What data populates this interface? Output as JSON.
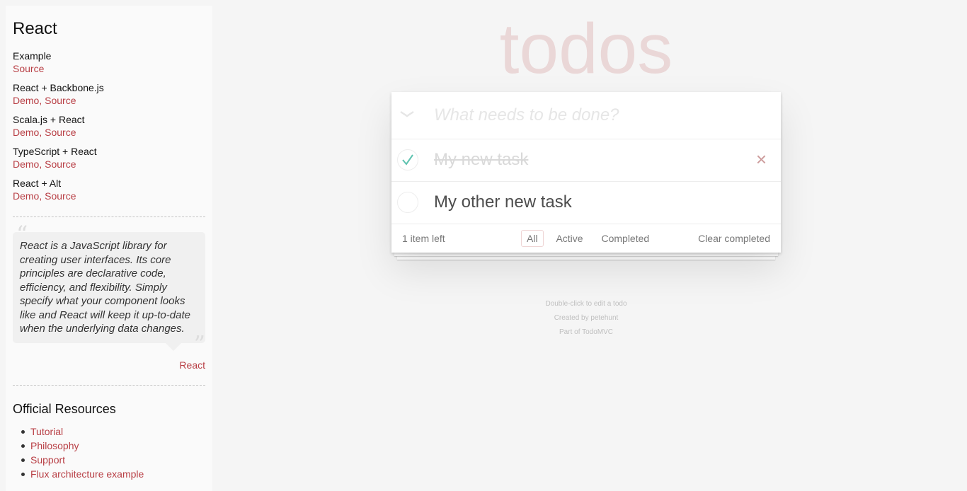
{
  "sidebar": {
    "title": "React",
    "examples": [
      {
        "name": "Example",
        "links": [
          "Source"
        ]
      },
      {
        "name": "React + Backbone.js",
        "links": [
          "Demo",
          "Source"
        ]
      },
      {
        "name": "Scala.js + React",
        "links": [
          "Demo",
          "Source"
        ]
      },
      {
        "name": "TypeScript + React",
        "links": [
          "Demo",
          "Source"
        ]
      },
      {
        "name": "React + Alt",
        "links": [
          "Demo",
          "Source"
        ]
      }
    ],
    "link_separator": ", ",
    "quote": {
      "text": "React is a JavaScript library for creating user interfaces. Its core principles are declarative code, efficiency, and flexibility. Simply specify what your component looks like and React will keep it up-to-date when the underlying data changes.",
      "source": "React",
      "open_mark": "“",
      "close_mark": "”"
    },
    "resources_title": "Official Resources",
    "resources": [
      "Tutorial",
      "Philosophy",
      "Support",
      "Flux architecture example"
    ]
  },
  "app": {
    "title": "todos",
    "new_todo_placeholder": "What needs to be done?",
    "new_todo_value": "",
    "toggle_all_glyph": "❯",
    "destroy_glyph": "×",
    "todos": [
      {
        "title": "My new task",
        "completed": true
      },
      {
        "title": "My other new task",
        "completed": false
      }
    ],
    "footer": {
      "count": "1 item left",
      "filters": [
        "All",
        "Active",
        "Completed"
      ],
      "selected_filter": "All",
      "clear": "Clear completed"
    }
  },
  "info": {
    "line1": "Double-click to edit a todo",
    "line2": "Created by petehunt",
    "line3": "Part of TodoMVC"
  },
  "colors": {
    "accent": "#b83f45",
    "check_green": "#5dc2af",
    "destroy": "#cc9a9a"
  }
}
